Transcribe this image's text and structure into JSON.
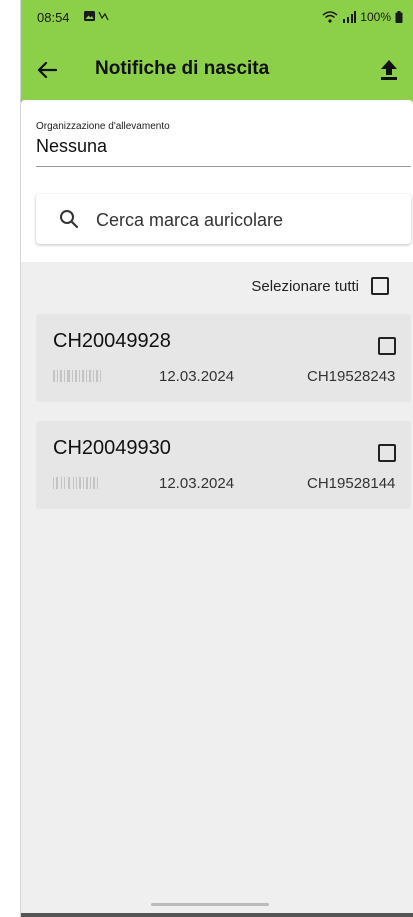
{
  "status_bar": {
    "time": "08:54",
    "battery": "100%"
  },
  "app_bar": {
    "back_icon": "back-arrow-icon",
    "title": "Notifiche di nascita",
    "upload_icon": "upload-icon"
  },
  "organization": {
    "label": "Organizzazione d'allevamento",
    "value": "Nessuna"
  },
  "search": {
    "placeholder": "Cerca marca auricolare",
    "value": ""
  },
  "select_all": {
    "label": "Selezionare tutti",
    "checked": false
  },
  "notifications": [
    {
      "id": "CH20049928",
      "date": "12.03.2024",
      "mother": "CH19528243",
      "checked": false
    },
    {
      "id": "CH20049930",
      "date": "12.03.2024",
      "mother": "CH19528144",
      "checked": false
    }
  ],
  "colors": {
    "accent": "#8cd04a",
    "background": "#efefef",
    "card": "#e6e6e6"
  }
}
